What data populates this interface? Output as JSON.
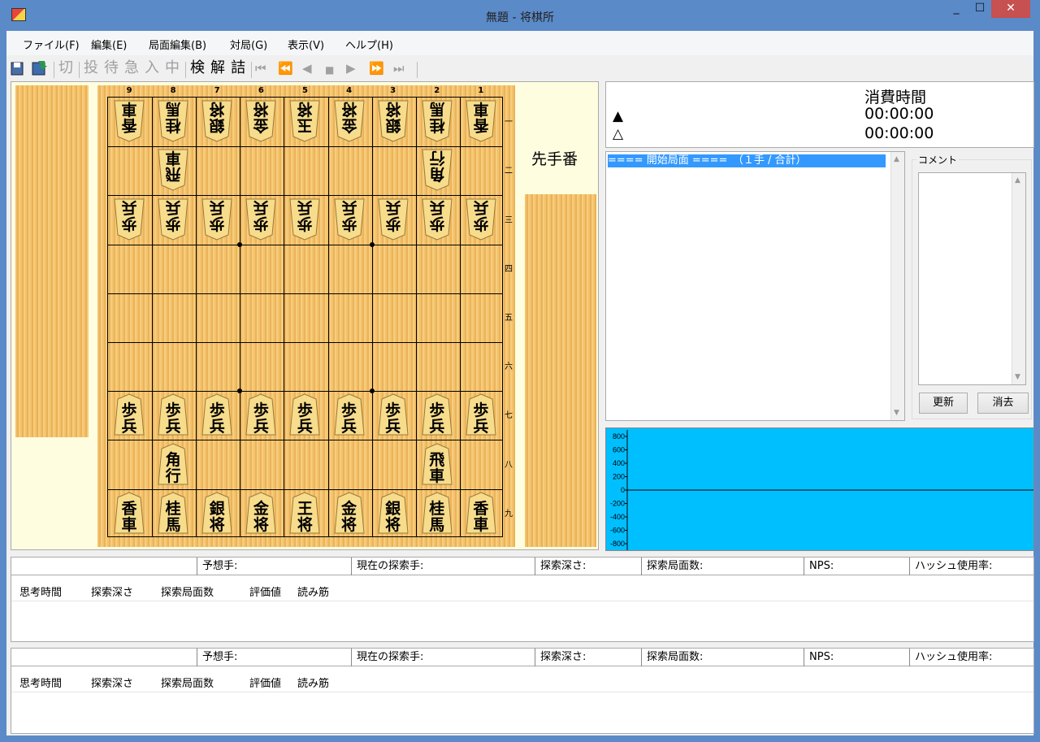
{
  "window": {
    "title": "無題 - 将棋所",
    "min_glyph": "_",
    "max_glyph": "☐",
    "close_glyph": "✕"
  },
  "menu": [
    "ファイル(F)",
    "編集(E)",
    "局面編集(B)",
    "対局(G)",
    "表示(V)",
    "ヘルプ(H)"
  ],
  "toolbar": {
    "open_icon": "open-file-icon",
    "save_icon": "save-file-icon",
    "kanji_buttons": [
      {
        "label": "切",
        "enabled": false
      },
      {
        "label": "投",
        "enabled": false
      },
      {
        "label": "待",
        "enabled": false
      },
      {
        "label": "急",
        "enabled": false
      },
      {
        "label": "入",
        "enabled": false
      },
      {
        "label": "中",
        "enabled": false
      },
      {
        "label": "検",
        "enabled": true
      },
      {
        "label": "解",
        "enabled": true
      },
      {
        "label": "詰",
        "enabled": true
      }
    ],
    "nav_buttons": [
      {
        "name": "first-move",
        "glyph": "⏮"
      },
      {
        "name": "prev-10",
        "glyph": "⏪"
      },
      {
        "name": "prev",
        "glyph": "◀"
      },
      {
        "name": "stop",
        "glyph": "■"
      },
      {
        "name": "next",
        "glyph": "▶"
      },
      {
        "name": "next-10",
        "glyph": "⏩"
      },
      {
        "name": "last-move",
        "glyph": "⏭"
      }
    ]
  },
  "board": {
    "files": [
      "9",
      "8",
      "7",
      "6",
      "5",
      "4",
      "3",
      "2",
      "1"
    ],
    "ranks": [
      "一",
      "二",
      "三",
      "四",
      "五",
      "六",
      "七",
      "八",
      "九"
    ],
    "gote_pieces": [
      {
        "file": 9,
        "rank": 1,
        "l1": "香",
        "l2": "車"
      },
      {
        "file": 8,
        "rank": 1,
        "l1": "桂",
        "l2": "馬"
      },
      {
        "file": 7,
        "rank": 1,
        "l1": "銀",
        "l2": "将"
      },
      {
        "file": 6,
        "rank": 1,
        "l1": "金",
        "l2": "将"
      },
      {
        "file": 5,
        "rank": 1,
        "l1": "玉",
        "l2": "将"
      },
      {
        "file": 4,
        "rank": 1,
        "l1": "金",
        "l2": "将"
      },
      {
        "file": 3,
        "rank": 1,
        "l1": "銀",
        "l2": "将"
      },
      {
        "file": 2,
        "rank": 1,
        "l1": "桂",
        "l2": "馬"
      },
      {
        "file": 1,
        "rank": 1,
        "l1": "香",
        "l2": "車"
      },
      {
        "file": 8,
        "rank": 2,
        "l1": "飛",
        "l2": "車"
      },
      {
        "file": 2,
        "rank": 2,
        "l1": "角",
        "l2": "行"
      },
      {
        "file": 9,
        "rank": 3,
        "l1": "歩",
        "l2": "兵"
      },
      {
        "file": 8,
        "rank": 3,
        "l1": "歩",
        "l2": "兵"
      },
      {
        "file": 7,
        "rank": 3,
        "l1": "歩",
        "l2": "兵"
      },
      {
        "file": 6,
        "rank": 3,
        "l1": "歩",
        "l2": "兵"
      },
      {
        "file": 5,
        "rank": 3,
        "l1": "歩",
        "l2": "兵"
      },
      {
        "file": 4,
        "rank": 3,
        "l1": "歩",
        "l2": "兵"
      },
      {
        "file": 3,
        "rank": 3,
        "l1": "歩",
        "l2": "兵"
      },
      {
        "file": 2,
        "rank": 3,
        "l1": "歩",
        "l2": "兵"
      },
      {
        "file": 1,
        "rank": 3,
        "l1": "歩",
        "l2": "兵"
      }
    ],
    "sente_pieces": [
      {
        "file": 9,
        "rank": 7,
        "l1": "歩",
        "l2": "兵"
      },
      {
        "file": 8,
        "rank": 7,
        "l1": "歩",
        "l2": "兵"
      },
      {
        "file": 7,
        "rank": 7,
        "l1": "歩",
        "l2": "兵"
      },
      {
        "file": 6,
        "rank": 7,
        "l1": "歩",
        "l2": "兵"
      },
      {
        "file": 5,
        "rank": 7,
        "l1": "歩",
        "l2": "兵"
      },
      {
        "file": 4,
        "rank": 7,
        "l1": "歩",
        "l2": "兵"
      },
      {
        "file": 3,
        "rank": 7,
        "l1": "歩",
        "l2": "兵"
      },
      {
        "file": 2,
        "rank": 7,
        "l1": "歩",
        "l2": "兵"
      },
      {
        "file": 1,
        "rank": 7,
        "l1": "歩",
        "l2": "兵"
      },
      {
        "file": 8,
        "rank": 8,
        "l1": "角",
        "l2": "行"
      },
      {
        "file": 2,
        "rank": 8,
        "l1": "飛",
        "l2": "車"
      },
      {
        "file": 9,
        "rank": 9,
        "l1": "香",
        "l2": "車"
      },
      {
        "file": 8,
        "rank": 9,
        "l1": "桂",
        "l2": "馬"
      },
      {
        "file": 7,
        "rank": 9,
        "l1": "銀",
        "l2": "将"
      },
      {
        "file": 6,
        "rank": 9,
        "l1": "金",
        "l2": "将"
      },
      {
        "file": 5,
        "rank": 9,
        "l1": "王",
        "l2": "将"
      },
      {
        "file": 4,
        "rank": 9,
        "l1": "金",
        "l2": "将"
      },
      {
        "file": 3,
        "rank": 9,
        "l1": "銀",
        "l2": "将"
      },
      {
        "file": 2,
        "rank": 9,
        "l1": "桂",
        "l2": "馬"
      },
      {
        "file": 1,
        "rank": 9,
        "l1": "香",
        "l2": "車"
      }
    ],
    "turn_label": "先手番"
  },
  "clock": {
    "header": "消費時間",
    "sente_mark": "▲",
    "gote_mark": "△",
    "sente_time": "00:00:00",
    "gote_time": "00:00:00"
  },
  "moves": {
    "selected": "==== 開始局面 ====　（１手 / 合計）"
  },
  "comment": {
    "label": "コメント",
    "update_button": "更新",
    "clear_button": "消去"
  },
  "graph": {
    "y_ticks": [
      "800",
      "600",
      "400",
      "200",
      "0",
      "-200",
      "-400",
      "-600",
      "-800"
    ],
    "background": "#00bfff"
  },
  "engine_panels": [
    {
      "status": [
        "予想手:",
        "現在の探索手:",
        "探索深さ:",
        "探索局面数:",
        "NPS:",
        "ハッシュ使用率:"
      ],
      "columns": [
        "思考時間",
        "探索深さ",
        "探索局面数",
        "評価値",
        "読み筋"
      ]
    },
    {
      "status": [
        "予想手:",
        "現在の探索手:",
        "探索深さ:",
        "探索局面数:",
        "NPS:",
        "ハッシュ使用率:"
      ],
      "columns": [
        "思考時間",
        "探索深さ",
        "探索局面数",
        "評価値",
        "読み筋"
      ]
    }
  ]
}
